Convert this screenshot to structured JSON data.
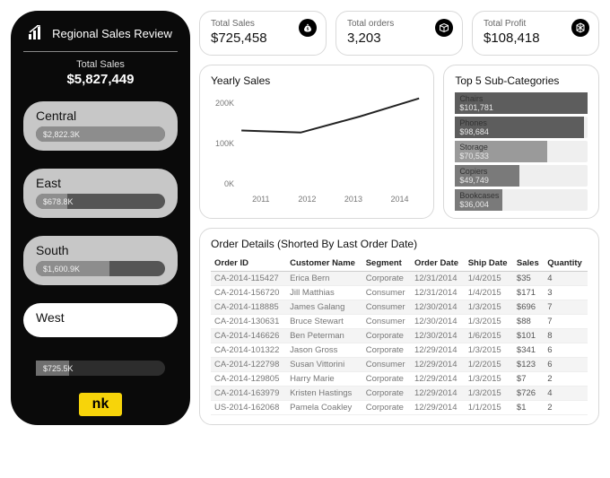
{
  "sidebar": {
    "title": "Regional Sales Review",
    "sub_label": "Total Sales",
    "total_value": "$5,827,449",
    "regions": [
      {
        "name": "Central",
        "value_label": "$2,822.3K",
        "pct": 100
      },
      {
        "name": "East",
        "value_label": "$678.8K",
        "pct": 24
      },
      {
        "name": "South",
        "value_label": "$1,600.9K",
        "pct": 57
      },
      {
        "name": "West",
        "value_label": "$725.5K",
        "pct": 26,
        "active": true
      }
    ],
    "logo_text": "nk"
  },
  "kpi": [
    {
      "label": "Total Sales",
      "value": "$725,458",
      "icon": "money-bag-icon"
    },
    {
      "label": "Total orders",
      "value": "3,203",
      "icon": "box-icon"
    },
    {
      "label": "Total Profit",
      "value": "$108,418",
      "icon": "cube-icon"
    }
  ],
  "line_chart": {
    "title": "Yearly Sales"
  },
  "chart_data": [
    {
      "type": "line",
      "title": "Yearly Sales",
      "xlabel": "",
      "ylabel": "",
      "x": [
        2011,
        2012,
        2013,
        2014
      ],
      "values": [
        155000,
        150000,
        190000,
        235000
      ],
      "ylim": [
        0,
        250000
      ],
      "yticks": [
        "0K",
        "100K",
        "200K"
      ]
    },
    {
      "type": "bar",
      "title": "Top 5 Sub-Categories",
      "orientation": "horizontal",
      "categories": [
        "Chairs",
        "Phones",
        "Storage",
        "Copiers",
        "Bookcases"
      ],
      "values": [
        101781,
        98684,
        70533,
        49749,
        36004
      ],
      "value_labels": [
        "$101,781",
        "$98,684",
        "$70,533",
        "$49,749",
        "$36,004"
      ],
      "xlim": [
        0,
        101781
      ]
    },
    {
      "type": "bar",
      "title": "Region Totals",
      "orientation": "horizontal",
      "categories": [
        "Central",
        "East",
        "South",
        "West"
      ],
      "values": [
        2822300,
        678800,
        1600900,
        725500
      ],
      "value_labels": [
        "$2,822.3K",
        "$678.8K",
        "$1,600.9K",
        "$725.5K"
      ]
    }
  ],
  "topcat": {
    "title": "Top 5 Sub-Categories"
  },
  "order_table": {
    "title": "Order Details (Shorted By Last Order Date)",
    "columns": [
      "Order ID",
      "Customer Name",
      "Segment",
      "Order Date",
      "Ship Date",
      "Sales",
      "Quantity"
    ],
    "rows": [
      [
        "CA-2014-115427",
        "Erica Bern",
        "Corporate",
        "12/31/2014",
        "1/4/2015",
        "$35",
        "4"
      ],
      [
        "CA-2014-156720",
        "Jill Matthias",
        "Consumer",
        "12/31/2014",
        "1/4/2015",
        "$171",
        "3"
      ],
      [
        "CA-2014-118885",
        "James Galang",
        "Consumer",
        "12/30/2014",
        "1/3/2015",
        "$696",
        "7"
      ],
      [
        "CA-2014-130631",
        "Bruce Stewart",
        "Consumer",
        "12/30/2014",
        "1/3/2015",
        "$88",
        "7"
      ],
      [
        "CA-2014-146626",
        "Ben Peterman",
        "Corporate",
        "12/30/2014",
        "1/6/2015",
        "$101",
        "8"
      ],
      [
        "CA-2014-101322",
        "Jason Gross",
        "Corporate",
        "12/29/2014",
        "1/3/2015",
        "$341",
        "6"
      ],
      [
        "CA-2014-122798",
        "Susan Vittorini",
        "Consumer",
        "12/29/2014",
        "1/2/2015",
        "$123",
        "6"
      ],
      [
        "CA-2014-129805",
        "Harry Marie",
        "Corporate",
        "12/29/2014",
        "1/3/2015",
        "$7",
        "2"
      ],
      [
        "CA-2014-163979",
        "Kristen Hastings",
        "Corporate",
        "12/29/2014",
        "1/3/2015",
        "$726",
        "4"
      ],
      [
        "US-2014-162068",
        "Pamela Coakley",
        "Corporate",
        "12/29/2014",
        "1/1/2015",
        "$1",
        "2"
      ]
    ]
  }
}
